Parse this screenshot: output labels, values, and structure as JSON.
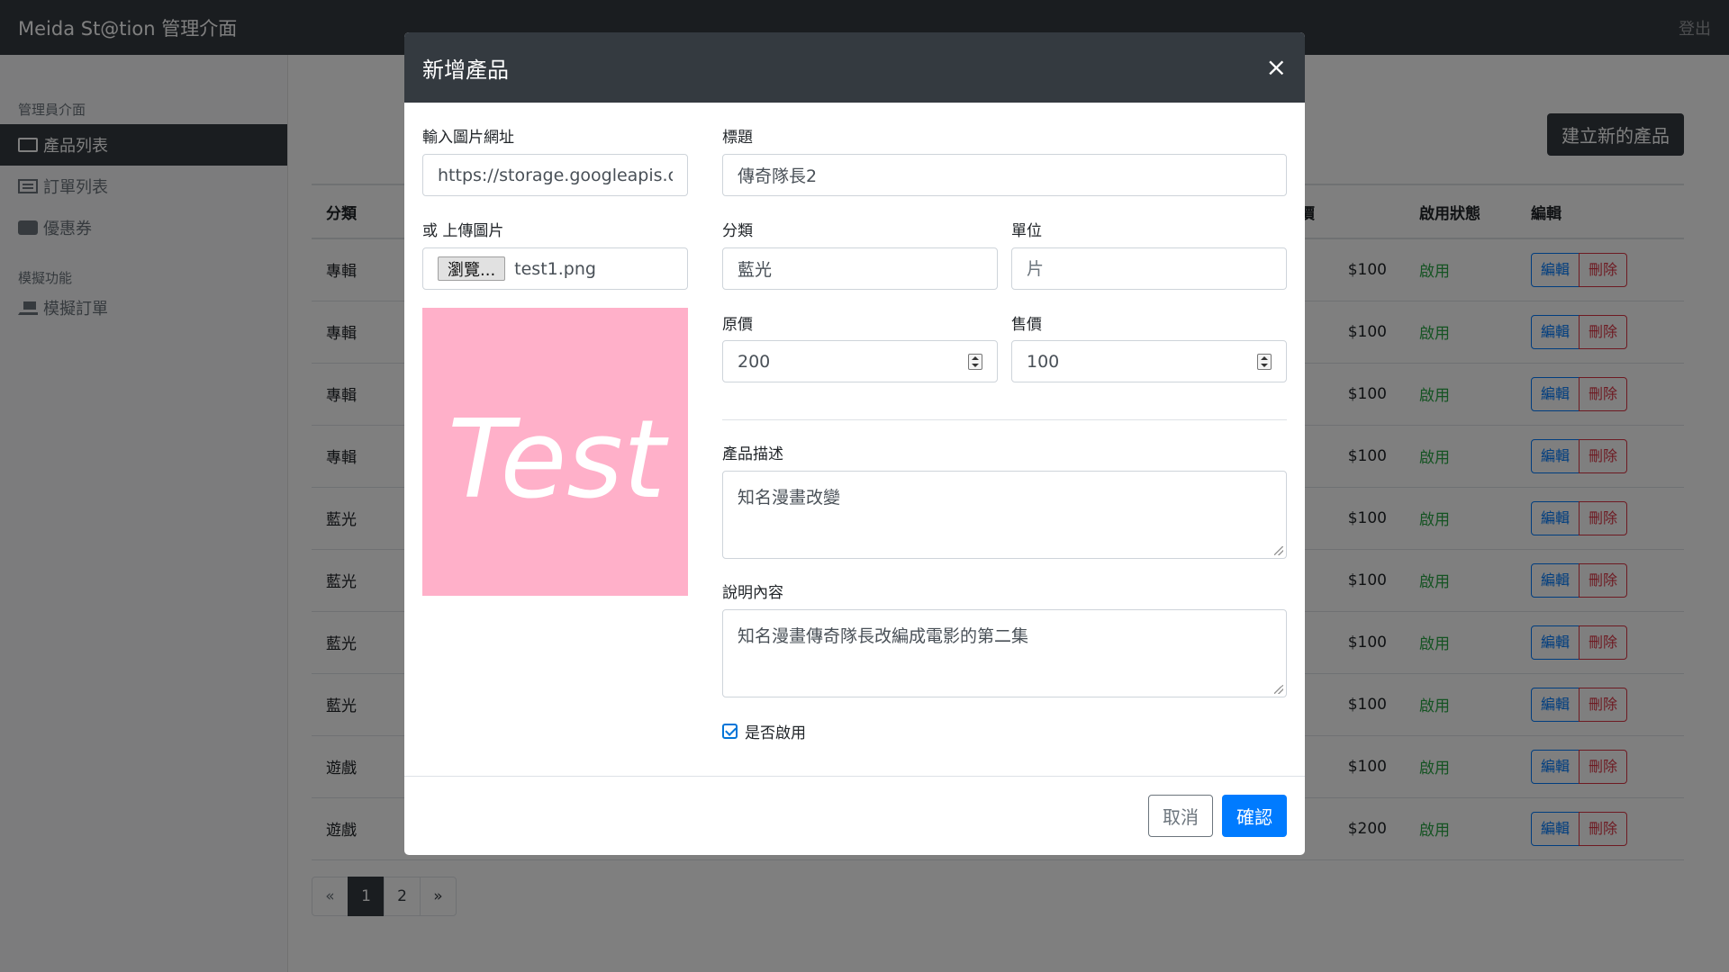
{
  "navbar": {
    "brand": "Meida St@tion 管理介面",
    "logout": "登出"
  },
  "sidebar": {
    "heading_admin": "管理員介面",
    "items": [
      {
        "label": "產品列表",
        "icon": "box-icon",
        "active": true
      },
      {
        "label": "訂單列表",
        "icon": "list-icon",
        "active": false
      },
      {
        "label": "優惠券",
        "icon": "ticket-icon",
        "active": false
      }
    ],
    "heading_sim": "模擬功能",
    "sim_items": [
      {
        "label": "模擬訂單",
        "icon": "cart-icon"
      }
    ]
  },
  "main": {
    "create_button": "建立新的產品",
    "table": {
      "headers": {
        "category": "分類",
        "price": "售價",
        "status": "啟用狀態",
        "edit": "編輯"
      },
      "rows": [
        {
          "category": "專輯",
          "price": "$100",
          "status": "啟用"
        },
        {
          "category": "專輯",
          "price": "$100",
          "status": "啟用"
        },
        {
          "category": "專輯",
          "price": "$100",
          "status": "啟用"
        },
        {
          "category": "專輯",
          "price": "$100",
          "status": "啟用"
        },
        {
          "category": "藍光",
          "price": "$100",
          "status": "啟用"
        },
        {
          "category": "藍光",
          "price": "$100",
          "status": "啟用"
        },
        {
          "category": "藍光",
          "price": "$100",
          "status": "啟用"
        },
        {
          "category": "藍光",
          "price": "$100",
          "status": "啟用"
        },
        {
          "category": "遊戲",
          "price": "$100",
          "status": "啟用"
        },
        {
          "category": "遊戲",
          "price": "$200",
          "status": "啟用"
        }
      ],
      "edit_label": "編輯",
      "delete_label": "刪除"
    },
    "pagination": {
      "prev": "«",
      "pages": [
        "1",
        "2"
      ],
      "current": "1",
      "next": "»"
    }
  },
  "modal": {
    "title": "新增產品",
    "close": "×",
    "image_url_label": "輸入圖片網址",
    "image_url_value": "https://storage.googleapis.com",
    "upload_label": "或 上傳圖片",
    "browse_button": "瀏覽...",
    "file_name": "test1.png",
    "preview_text": "Test",
    "title_label": "標題",
    "title_value": "傳奇隊長2",
    "category_label": "分類",
    "category_value": "藍光",
    "unit_label": "單位",
    "unit_placeholder": "片",
    "origin_price_label": "原價",
    "origin_price_value": "200",
    "price_label": "售價",
    "price_value": "100",
    "description_label": "產品描述",
    "description_value": "知名漫畫改變",
    "content_label": "說明內容",
    "content_value": "知名漫畫傳奇隊長改編成電影的第二集",
    "enabled_label": "是否啟用",
    "enabled": true,
    "cancel_button": "取消",
    "confirm_button": "確認"
  }
}
